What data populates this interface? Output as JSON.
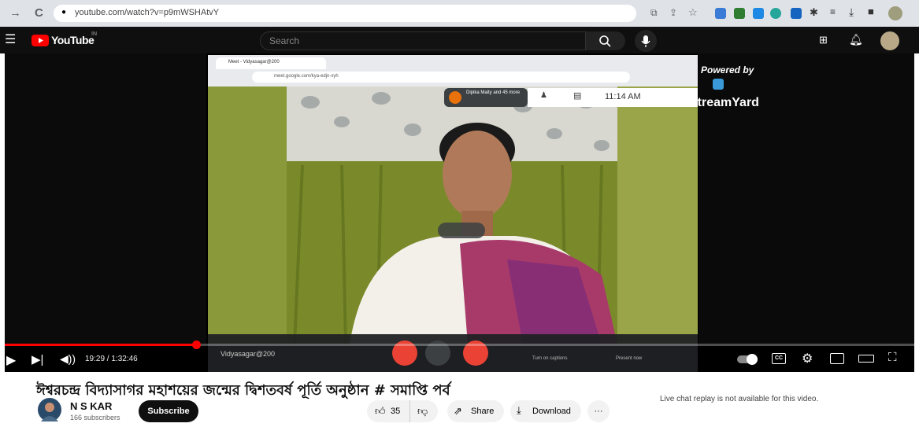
{
  "browser": {
    "url": "youtube.com/watch?v=p9mWSHAtvY",
    "nav": {
      "back": "←",
      "forward": "→",
      "reload": "C",
      "lock": "🔒"
    }
  },
  "header": {
    "logo_text": "YouTube",
    "logo_country": "IN",
    "search_placeholder": "Search"
  },
  "meet": {
    "tab_title": "Meet - Vidyasagar@200",
    "url": "meet.google.com/kya-edjn-xyh",
    "participant_badge": "Dipika Maity and 45 more",
    "time": "11:14 AM",
    "meeting_name": "Vidyasagar@200",
    "captions_label": "Turn on captions",
    "present_label": "Present now"
  },
  "streamyard": {
    "powered_by": "Powered by",
    "name": "StreamYard"
  },
  "player": {
    "time": "19:29 / 1:32:46",
    "progress": 0.21
  },
  "video": {
    "title": "ঈশ্বরচন্দ্র বিদ্যাসাগর মহাশয়ের জন্মের দ্বিশতবর্ষ পূর্তি অনুষ্ঠান # সমাপ্তি পর্ব",
    "channel": "N S KAR",
    "subscribers": "166 subscribers",
    "subscribe_label": "Subscribe",
    "likes": "35",
    "share_label": "Share",
    "download_label": "Download",
    "more_label": "···"
  },
  "chat_note": "Live chat replay is not available for this video."
}
